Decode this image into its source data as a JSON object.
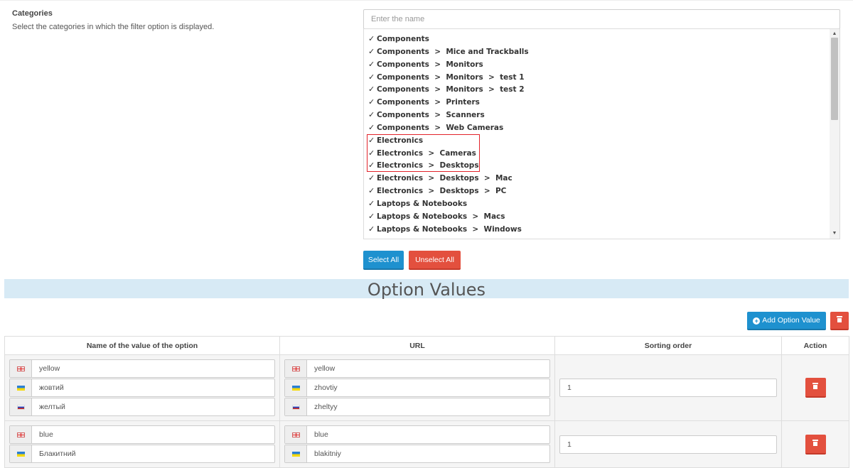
{
  "categories": {
    "title": "Categories",
    "help_text": "Select the categories in which the filter option is displayed.",
    "search_placeholder": "Enter the name",
    "items": [
      "Components",
      "Components  >  Mice and Trackballs",
      "Components  >  Monitors",
      "Components  >  Monitors  >  test 1",
      "Components  >  Monitors  >  test 2",
      "Components  >  Printers",
      "Components  >  Scanners",
      "Components  >  Web Cameras",
      "Electronics",
      "Electronics  >  Cameras",
      "Electronics  >  Desktops",
      "Electronics  >  Desktops  >  Mac",
      "Electronics  >  Desktops  >  PC",
      "Laptops & Notebooks",
      "Laptops & Notebooks  >  Macs",
      "Laptops & Notebooks  >  Windows"
    ],
    "check_glyph": "✓",
    "select_all_label": "Select All",
    "unselect_all_label": "Unselect All"
  },
  "option_values": {
    "heading": "Option Values",
    "add_label": "Add Option Value",
    "columns": [
      "Name of the value of the option",
      "URL",
      "Sorting order",
      "Action"
    ],
    "rows": [
      {
        "names": [
          {
            "lang": "en",
            "value": "yellow"
          },
          {
            "lang": "uk",
            "value": "жовтий"
          },
          {
            "lang": "ru",
            "value": "желтый"
          }
        ],
        "urls": [
          {
            "lang": "en",
            "value": "yellow"
          },
          {
            "lang": "uk",
            "value": "zhovtiy"
          },
          {
            "lang": "ru",
            "value": "zheltyy"
          }
        ],
        "sort": "1"
      },
      {
        "names": [
          {
            "lang": "en",
            "value": "blue"
          },
          {
            "lang": "uk",
            "value": "Блакитний"
          }
        ],
        "urls": [
          {
            "lang": "en",
            "value": "blue"
          },
          {
            "lang": "uk",
            "value": "blakitniy"
          }
        ],
        "sort": "1"
      }
    ]
  },
  "colors": {
    "primary": "#1e91cf",
    "danger": "#e3503e",
    "banner": "#d7eaf5",
    "highlight": "#e2232a"
  },
  "icons": [
    "check-icon",
    "plus-circle-icon",
    "trash-icon",
    "flag-en-icon",
    "flag-uk-icon",
    "flag-ru-icon"
  ]
}
